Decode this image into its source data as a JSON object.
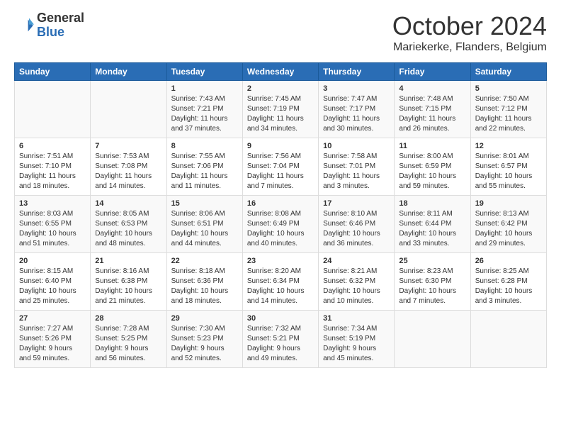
{
  "logo": {
    "general": "General",
    "blue": "Blue"
  },
  "title": "October 2024",
  "location": "Mariekerke, Flanders, Belgium",
  "days": [
    "Sunday",
    "Monday",
    "Tuesday",
    "Wednesday",
    "Thursday",
    "Friday",
    "Saturday"
  ],
  "weeks": [
    [
      {
        "num": "",
        "info": ""
      },
      {
        "num": "",
        "info": ""
      },
      {
        "num": "1",
        "info": "Sunrise: 7:43 AM\nSunset: 7:21 PM\nDaylight: 11 hours and 37 minutes."
      },
      {
        "num": "2",
        "info": "Sunrise: 7:45 AM\nSunset: 7:19 PM\nDaylight: 11 hours and 34 minutes."
      },
      {
        "num": "3",
        "info": "Sunrise: 7:47 AM\nSunset: 7:17 PM\nDaylight: 11 hours and 30 minutes."
      },
      {
        "num": "4",
        "info": "Sunrise: 7:48 AM\nSunset: 7:15 PM\nDaylight: 11 hours and 26 minutes."
      },
      {
        "num": "5",
        "info": "Sunrise: 7:50 AM\nSunset: 7:12 PM\nDaylight: 11 hours and 22 minutes."
      }
    ],
    [
      {
        "num": "6",
        "info": "Sunrise: 7:51 AM\nSunset: 7:10 PM\nDaylight: 11 hours and 18 minutes."
      },
      {
        "num": "7",
        "info": "Sunrise: 7:53 AM\nSunset: 7:08 PM\nDaylight: 11 hours and 14 minutes."
      },
      {
        "num": "8",
        "info": "Sunrise: 7:55 AM\nSunset: 7:06 PM\nDaylight: 11 hours and 11 minutes."
      },
      {
        "num": "9",
        "info": "Sunrise: 7:56 AM\nSunset: 7:04 PM\nDaylight: 11 hours and 7 minutes."
      },
      {
        "num": "10",
        "info": "Sunrise: 7:58 AM\nSunset: 7:01 PM\nDaylight: 11 hours and 3 minutes."
      },
      {
        "num": "11",
        "info": "Sunrise: 8:00 AM\nSunset: 6:59 PM\nDaylight: 10 hours and 59 minutes."
      },
      {
        "num": "12",
        "info": "Sunrise: 8:01 AM\nSunset: 6:57 PM\nDaylight: 10 hours and 55 minutes."
      }
    ],
    [
      {
        "num": "13",
        "info": "Sunrise: 8:03 AM\nSunset: 6:55 PM\nDaylight: 10 hours and 51 minutes."
      },
      {
        "num": "14",
        "info": "Sunrise: 8:05 AM\nSunset: 6:53 PM\nDaylight: 10 hours and 48 minutes."
      },
      {
        "num": "15",
        "info": "Sunrise: 8:06 AM\nSunset: 6:51 PM\nDaylight: 10 hours and 44 minutes."
      },
      {
        "num": "16",
        "info": "Sunrise: 8:08 AM\nSunset: 6:49 PM\nDaylight: 10 hours and 40 minutes."
      },
      {
        "num": "17",
        "info": "Sunrise: 8:10 AM\nSunset: 6:46 PM\nDaylight: 10 hours and 36 minutes."
      },
      {
        "num": "18",
        "info": "Sunrise: 8:11 AM\nSunset: 6:44 PM\nDaylight: 10 hours and 33 minutes."
      },
      {
        "num": "19",
        "info": "Sunrise: 8:13 AM\nSunset: 6:42 PM\nDaylight: 10 hours and 29 minutes."
      }
    ],
    [
      {
        "num": "20",
        "info": "Sunrise: 8:15 AM\nSunset: 6:40 PM\nDaylight: 10 hours and 25 minutes."
      },
      {
        "num": "21",
        "info": "Sunrise: 8:16 AM\nSunset: 6:38 PM\nDaylight: 10 hours and 21 minutes."
      },
      {
        "num": "22",
        "info": "Sunrise: 8:18 AM\nSunset: 6:36 PM\nDaylight: 10 hours and 18 minutes."
      },
      {
        "num": "23",
        "info": "Sunrise: 8:20 AM\nSunset: 6:34 PM\nDaylight: 10 hours and 14 minutes."
      },
      {
        "num": "24",
        "info": "Sunrise: 8:21 AM\nSunset: 6:32 PM\nDaylight: 10 hours and 10 minutes."
      },
      {
        "num": "25",
        "info": "Sunrise: 8:23 AM\nSunset: 6:30 PM\nDaylight: 10 hours and 7 minutes."
      },
      {
        "num": "26",
        "info": "Sunrise: 8:25 AM\nSunset: 6:28 PM\nDaylight: 10 hours and 3 minutes."
      }
    ],
    [
      {
        "num": "27",
        "info": "Sunrise: 7:27 AM\nSunset: 5:26 PM\nDaylight: 9 hours and 59 minutes."
      },
      {
        "num": "28",
        "info": "Sunrise: 7:28 AM\nSunset: 5:25 PM\nDaylight: 9 hours and 56 minutes."
      },
      {
        "num": "29",
        "info": "Sunrise: 7:30 AM\nSunset: 5:23 PM\nDaylight: 9 hours and 52 minutes."
      },
      {
        "num": "30",
        "info": "Sunrise: 7:32 AM\nSunset: 5:21 PM\nDaylight: 9 hours and 49 minutes."
      },
      {
        "num": "31",
        "info": "Sunrise: 7:34 AM\nSunset: 5:19 PM\nDaylight: 9 hours and 45 minutes."
      },
      {
        "num": "",
        "info": ""
      },
      {
        "num": "",
        "info": ""
      }
    ]
  ]
}
